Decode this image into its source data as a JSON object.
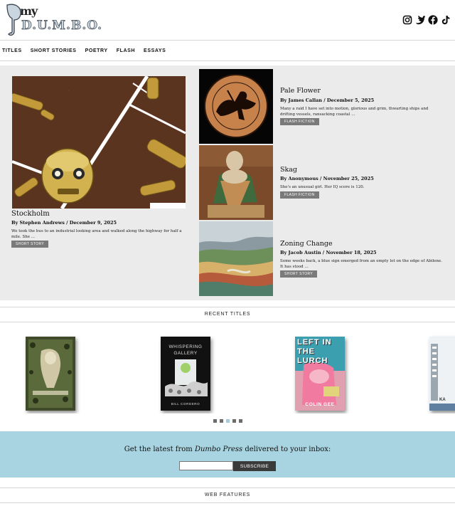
{
  "header": {
    "logo_my": "my",
    "logo_dumbo": "D.U.M.B.O.",
    "social": [
      "instagram-icon",
      "twitter-icon",
      "facebook-icon",
      "tiktok-icon"
    ]
  },
  "nav": {
    "items": [
      "TITLES",
      "SHORT STORIES",
      "POETRY",
      "FLASH",
      "ESSAYS"
    ]
  },
  "featured": {
    "main": {
      "title": "Stockholm",
      "byline": "By Stephen Andrews / December 9, 2025",
      "excerpt": "We took the bus to an industrial looking area and walked along the highway for half a mile. She ...",
      "tag": "SHORT STORY"
    },
    "side": [
      {
        "title": "Pale Flower",
        "byline": "By James Callan / December 5, 2025",
        "excerpt": "Many a raid I have set into motion, glorious and grim, thwarting ships and drifting vessels, ransacking coastal ...",
        "tag": "FLASH FICTION"
      },
      {
        "title": "Skag",
        "byline": "By Anonymous / November 25, 2025",
        "excerpt": "She's an unusual girl. Her IQ score is 120.",
        "tag": "FLASH FICTION"
      },
      {
        "title": "Zoning Change",
        "byline": "By Jacob Austin / November 18, 2025",
        "excerpt": "Some weeks back, a blue sign emerged from an empty lot on the edge of Abilene. It has stood ...",
        "tag": "SHORT STORY"
      }
    ]
  },
  "recent": {
    "heading": "RECENT TITLES",
    "books": [
      {
        "text": "",
        "author": ""
      },
      {
        "text": "WHISPERING GALLERY",
        "author": "BILL CORDERO"
      },
      {
        "text": "LEFT IN THE LURCH",
        "author": "COLIN GEE"
      },
      {
        "text": "",
        "author": "KA"
      }
    ],
    "active_dot": 3,
    "dot_count": 5
  },
  "newsletter": {
    "text_prefix": "Get the latest from ",
    "text_em": "Dumbo Press",
    "text_suffix": " delivered to your inbox:",
    "input_value": "",
    "button": "SUBSCRIBE"
  },
  "web_features": {
    "heading": "WEB FEATURES"
  }
}
